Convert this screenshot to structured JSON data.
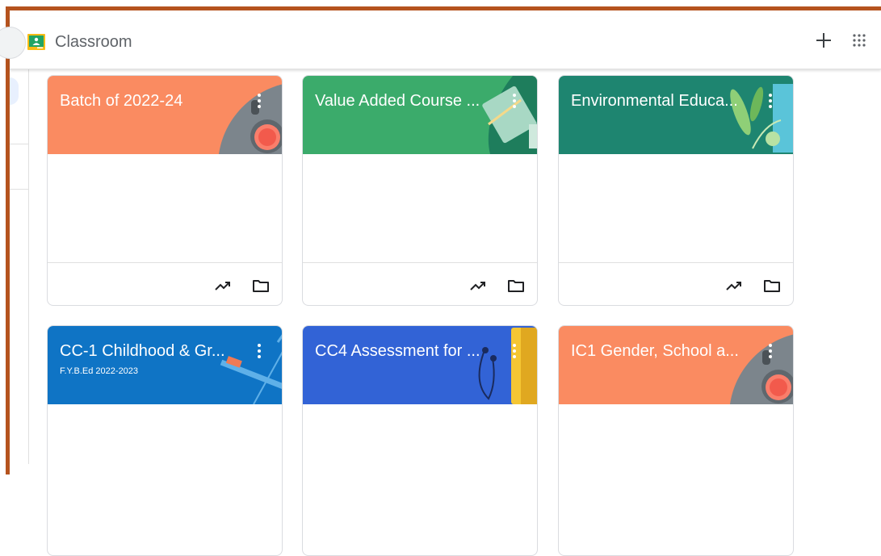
{
  "app": {
    "title": "Classroom",
    "logo_icon": "classroom-logo-icon",
    "create_icon": "plus-icon",
    "apps_icon": "apps-grid-icon"
  },
  "colors": {
    "frame_border": "#b5531e",
    "orange": "#fa8b61",
    "green": "#3bab6b",
    "teal": "#1e8570",
    "blue": "#0f74c5",
    "indigo": "#3263d6"
  },
  "cards": [
    {
      "title": "Batch of 2022-24",
      "subtitle": "",
      "color": "#fa8b61"
    },
    {
      "title": "Value Added Course ...",
      "subtitle": "",
      "color": "#3bab6b"
    },
    {
      "title": "Environmental Educa...",
      "subtitle": "",
      "color": "#1e8570"
    },
    {
      "title": "CC-1 Childhood & Gr...",
      "subtitle": "F.Y.B.Ed 2022-2023",
      "color": "#0f74c5"
    },
    {
      "title": "CC4 Assessment for ...",
      "subtitle": "",
      "color": "#3263d6"
    },
    {
      "title": "IC1 Gender, School a...",
      "subtitle": "",
      "color": "#fa8b61"
    }
  ],
  "card_icons": {
    "menu": "more-vert-icon",
    "progress": "trending-up-icon",
    "folder": "folder-icon"
  }
}
